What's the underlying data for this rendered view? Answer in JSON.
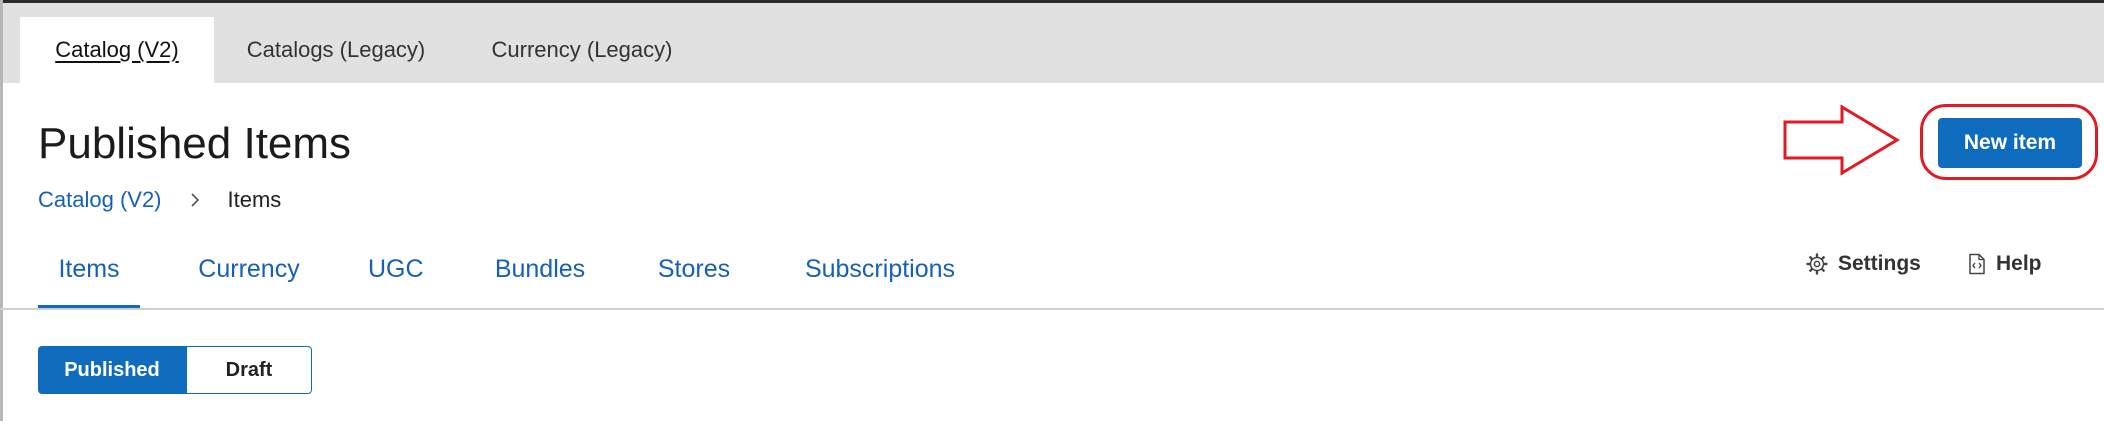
{
  "top_tabs": [
    {
      "label": "Catalog (V2)",
      "active": true
    },
    {
      "label": "Catalogs (Legacy)",
      "active": false
    },
    {
      "label": "Currency (Legacy)",
      "active": false
    }
  ],
  "page": {
    "title": "Published Items"
  },
  "breadcrumb": {
    "parent": "Catalog (V2)",
    "separator_icon": "chevron-right-icon",
    "current": "Items"
  },
  "sub_tabs": [
    {
      "label": "Items",
      "active": true
    },
    {
      "label": "Currency",
      "active": false
    },
    {
      "label": "UGC",
      "active": false
    },
    {
      "label": "Bundles",
      "active": false
    },
    {
      "label": "Stores",
      "active": false
    },
    {
      "label": "Subscriptions",
      "active": false
    }
  ],
  "toolbar": {
    "settings_label": "Settings",
    "settings_icon": "gear-icon",
    "help_label": "Help",
    "help_icon": "document-code-icon",
    "new_item_label": "New item"
  },
  "status_toggle": {
    "options": [
      "Published",
      "Draft"
    ],
    "selected": "Published"
  },
  "annotation": {
    "color": "#e01b24",
    "shapes": [
      "right-arrow",
      "rounded-rectangle"
    ]
  },
  "colors": {
    "accent": "#0f6cbd",
    "link": "#1660b8",
    "tab_bar": "#e1e1e1"
  }
}
